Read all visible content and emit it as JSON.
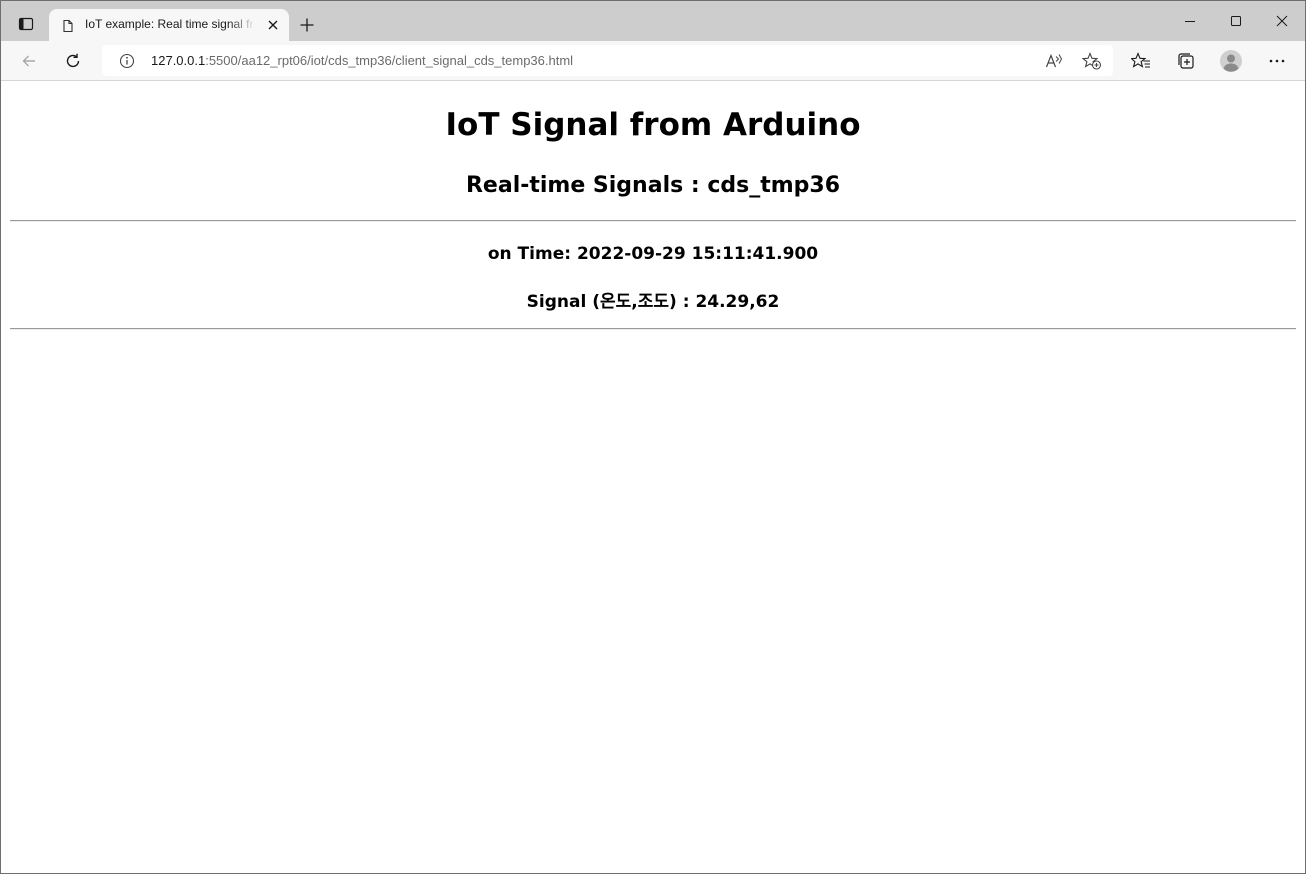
{
  "browser": {
    "tab": {
      "title": "IoT example: Real time signal from Arduino"
    },
    "address": {
      "host": "127.0.0.1",
      "rest": ":5500/aa12_rpt06/iot/cds_tmp36/client_signal_cds_temp36.html"
    }
  },
  "page": {
    "heading": "IoT Signal from Arduino",
    "subheading": "Real-time Signals : cds_tmp36",
    "time_label": "on Time: ",
    "time_value": "2022-09-29 15:11:41.900",
    "signal_label": "Signal (온도,조도) : ",
    "signal_value": "24.29,62"
  },
  "icons": {
    "tab_actions": "tab-actions-icon",
    "favicon": "page-icon",
    "tab_close": "close-icon",
    "new_tab": "plus-icon",
    "minimize": "minimize-icon",
    "maximize": "maximize-icon",
    "close_window": "close-icon",
    "back": "back-arrow-icon",
    "reload": "reload-icon",
    "site_info": "info-icon",
    "read_aloud": "read-aloud-icon",
    "add_favorite": "star-plus-icon",
    "favorites": "favorites-icon",
    "collections": "collections-icon",
    "profile": "profile-icon",
    "more": "more-icon"
  }
}
